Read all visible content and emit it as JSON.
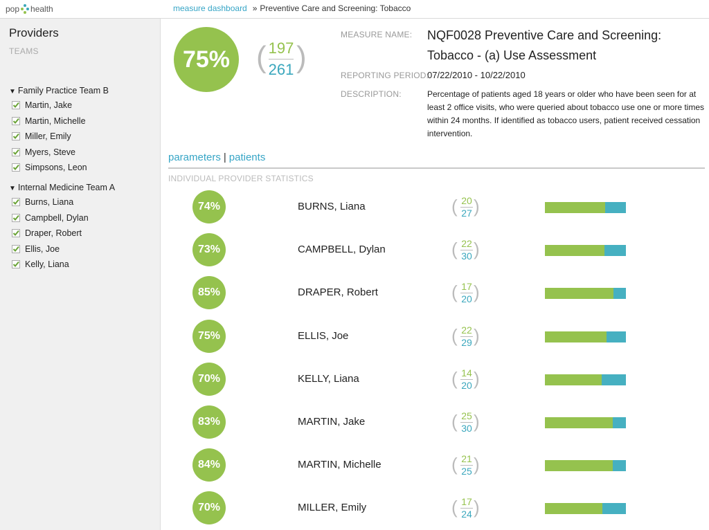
{
  "brand": {
    "left": "pop",
    "right": "health"
  },
  "breadcrumb": {
    "link": "measure dashboard",
    "sep": "»",
    "current": "Preventive Care and Screening: Tobacco"
  },
  "sidebar": {
    "title": "Providers",
    "subtitle": "TEAMS",
    "teams": [
      {
        "name": "Family Practice Team B",
        "providers": [
          "Martin, Jake",
          "Martin, Michelle",
          "Miller, Emily",
          "Myers, Steve",
          "Simpsons, Leon"
        ]
      },
      {
        "name": "Internal Medicine Team A",
        "providers": [
          "Burns, Liana",
          "Campbell, Dylan",
          "Draper, Robert",
          "Ellis, Joe",
          "Kelly, Liana"
        ]
      }
    ]
  },
  "measure": {
    "percent": "75%",
    "numerator": "197",
    "denominator": "261",
    "name_label": "MEASURE NAME:",
    "name": "NQF0028 Preventive Care and Screening: Tobacco - (a) Use Assessment",
    "period_label": "REPORTING PERIOD:",
    "period": "07/22/2010 - 10/22/2010",
    "description_label": "DESCRIPTION:",
    "description": "Percentage of patients aged 18 years or older who have been seen for at least 2 office visits, who were queried about tobacco use one or more times within 24 months. If identified as tobacco users, patient received cessation intervention."
  },
  "tabs": {
    "parameters": "parameters",
    "sep": "|",
    "patients": "patients"
  },
  "stats_heading": "INDIVIDUAL PROVIDER STATISTICS",
  "providers": [
    {
      "percent": "74%",
      "name": "BURNS, Liana",
      "num": "20",
      "den": "27"
    },
    {
      "percent": "73%",
      "name": "CAMPBELL, Dylan",
      "num": "22",
      "den": "30"
    },
    {
      "percent": "85%",
      "name": "DRAPER, Robert",
      "num": "17",
      "den": "20"
    },
    {
      "percent": "75%",
      "name": "ELLIS, Joe",
      "num": "22",
      "den": "29"
    },
    {
      "percent": "70%",
      "name": "KELLY, Liana",
      "num": "14",
      "den": "20"
    },
    {
      "percent": "83%",
      "name": "MARTIN, Jake",
      "num": "25",
      "den": "30"
    },
    {
      "percent": "84%",
      "name": "MARTIN, Michelle",
      "num": "21",
      "den": "25"
    },
    {
      "percent": "70%",
      "name": "MILLER, Emily",
      "num": "17",
      "den": "24"
    }
  ],
  "colors": {
    "accent_green": "#95c24e",
    "accent_teal": "#46b0c1",
    "link": "#36a5c6"
  }
}
